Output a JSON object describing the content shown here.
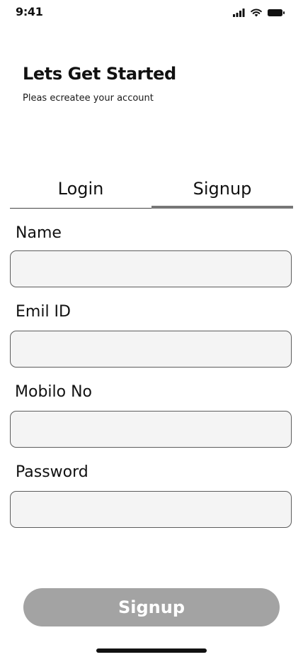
{
  "status_bar": {
    "time": "9:41",
    "icons": [
      "signal-icon",
      "wifi-icon",
      "battery-icon"
    ]
  },
  "header": {
    "title": "Lets Get Started",
    "subtitle": "Pleas ecreatee your account"
  },
  "tabs": {
    "items": [
      {
        "label": "Login",
        "active": false
      },
      {
        "label": "Signup",
        "active": true
      }
    ]
  },
  "form": {
    "fields": [
      {
        "label": "Name",
        "value": ""
      },
      {
        "label": "Emil ID",
        "value": ""
      },
      {
        "label": "Mobilo No",
        "value": ""
      },
      {
        "label": "Password",
        "value": ""
      }
    ]
  },
  "submit": {
    "label": "Signup"
  },
  "colors": {
    "input_background": "#f4f4f4",
    "button_background": "#a3a3a3",
    "active_tab_indicator": "#777777"
  }
}
